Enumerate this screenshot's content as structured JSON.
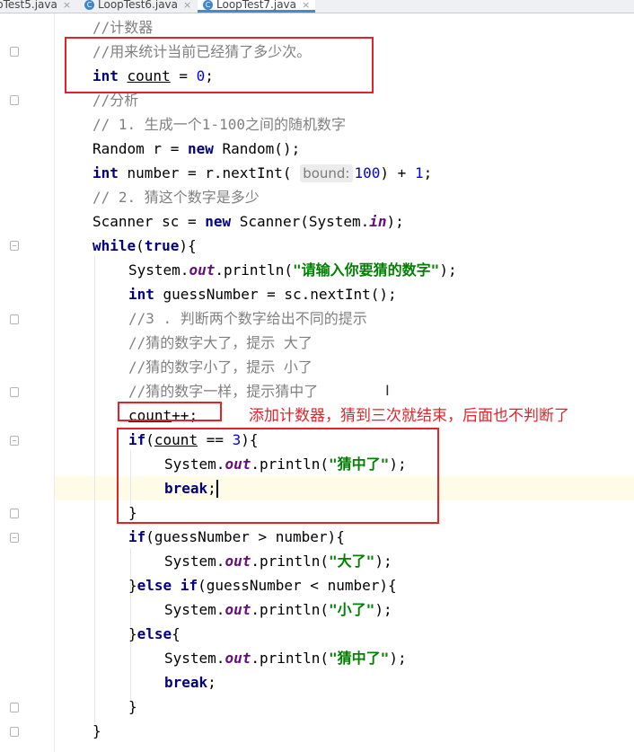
{
  "tabs": [
    {
      "label": "pTest5.java",
      "close": "×"
    },
    {
      "label": "LoopTest6.java",
      "close": "×"
    },
    {
      "label": "LoopTest7.java",
      "close": "×"
    }
  ],
  "tab_icon_letter": "C",
  "param_hint": "bound:",
  "code": {
    "l1": "//计数器",
    "l2": "//用来统计当前已经猜了多少次。",
    "l3_kw": "int ",
    "l3_var": "count",
    "l3_mid": " = ",
    "l3_num": "0",
    "l3_end": ";",
    "l4": "//分析",
    "l5": "// 1. 生成一个1-100之间的随机数字",
    "l6_a": "Random r = ",
    "l6_kw": "new",
    "l6_b": " Random();",
    "l7_kw": "int",
    "l7_a": " number = r.nextInt( ",
    "l7_num": "100",
    "l7_b": ") + ",
    "l7_num2": "1",
    "l7_end": ";",
    "l8": "// 2. 猜这个数字是多少",
    "l9_a": "Scanner sc = ",
    "l9_kw": "new",
    "l9_b": " Scanner(System.",
    "l9_fld": "in",
    "l9_end": ");",
    "l10_kw": "while",
    "l10_a": "(",
    "l10_kw2": "true",
    "l10_b": "){",
    "l11_a": "System.",
    "l11_fld": "out",
    "l11_b": ".println(",
    "l11_str": "\"请输入你要猜的数字\"",
    "l11_end": ");",
    "l12_kw": "int",
    "l12_a": " guessNumber = sc.nextInt();",
    "l13": "//3 . 判断两个数字给出不同的提示",
    "l14": "//猜的数字大了，提示 大了",
    "l15": "//猜的数字小了，提示 小了",
    "l16": "//猜的数字一样，提示猜中了",
    "l17_var": "count",
    "l17_end": "++;",
    "l18_kw": "if",
    "l18_a": "(",
    "l18_var": "count",
    "l18_b": " == ",
    "l18_num": "3",
    "l18_end": "){",
    "l19_a": "System.",
    "l19_fld": "out",
    "l19_b": ".println(",
    "l19_str": "\"猜中了\"",
    "l19_end": ");",
    "l20_kw": "break",
    "l20_end": ";",
    "l21": "}",
    "l22_kw": "if",
    "l22_a": "(guessNumber > number){",
    "l23_a": "System.",
    "l23_fld": "out",
    "l23_b": ".println(",
    "l23_str": "\"大了\"",
    "l23_end": ");",
    "l24_a": "}",
    "l24_kw": "else if",
    "l24_b": "(guessNumber < number){",
    "l25_a": "System.",
    "l25_fld": "out",
    "l25_b": ".println(",
    "l25_str": "\"小了\"",
    "l25_end": ");",
    "l26_a": "}",
    "l26_kw": "else",
    "l26_b": "{",
    "l27_a": "System.",
    "l27_fld": "out",
    "l27_b": ".println(",
    "l27_str": "\"猜中了\"",
    "l27_end": ");",
    "l28_kw": "break",
    "l28_end": ";",
    "l29": "}",
    "l30": "}"
  },
  "annotation": "添加计数器，猜到三次就结束，后面也不判断了",
  "colors": {
    "annotation": "#e4222a",
    "comment": "#808080",
    "keyword": "#000080",
    "string": "#008000",
    "number": "#0000ff",
    "static_field": "#660e7a",
    "current_line": "#fefbe6"
  }
}
